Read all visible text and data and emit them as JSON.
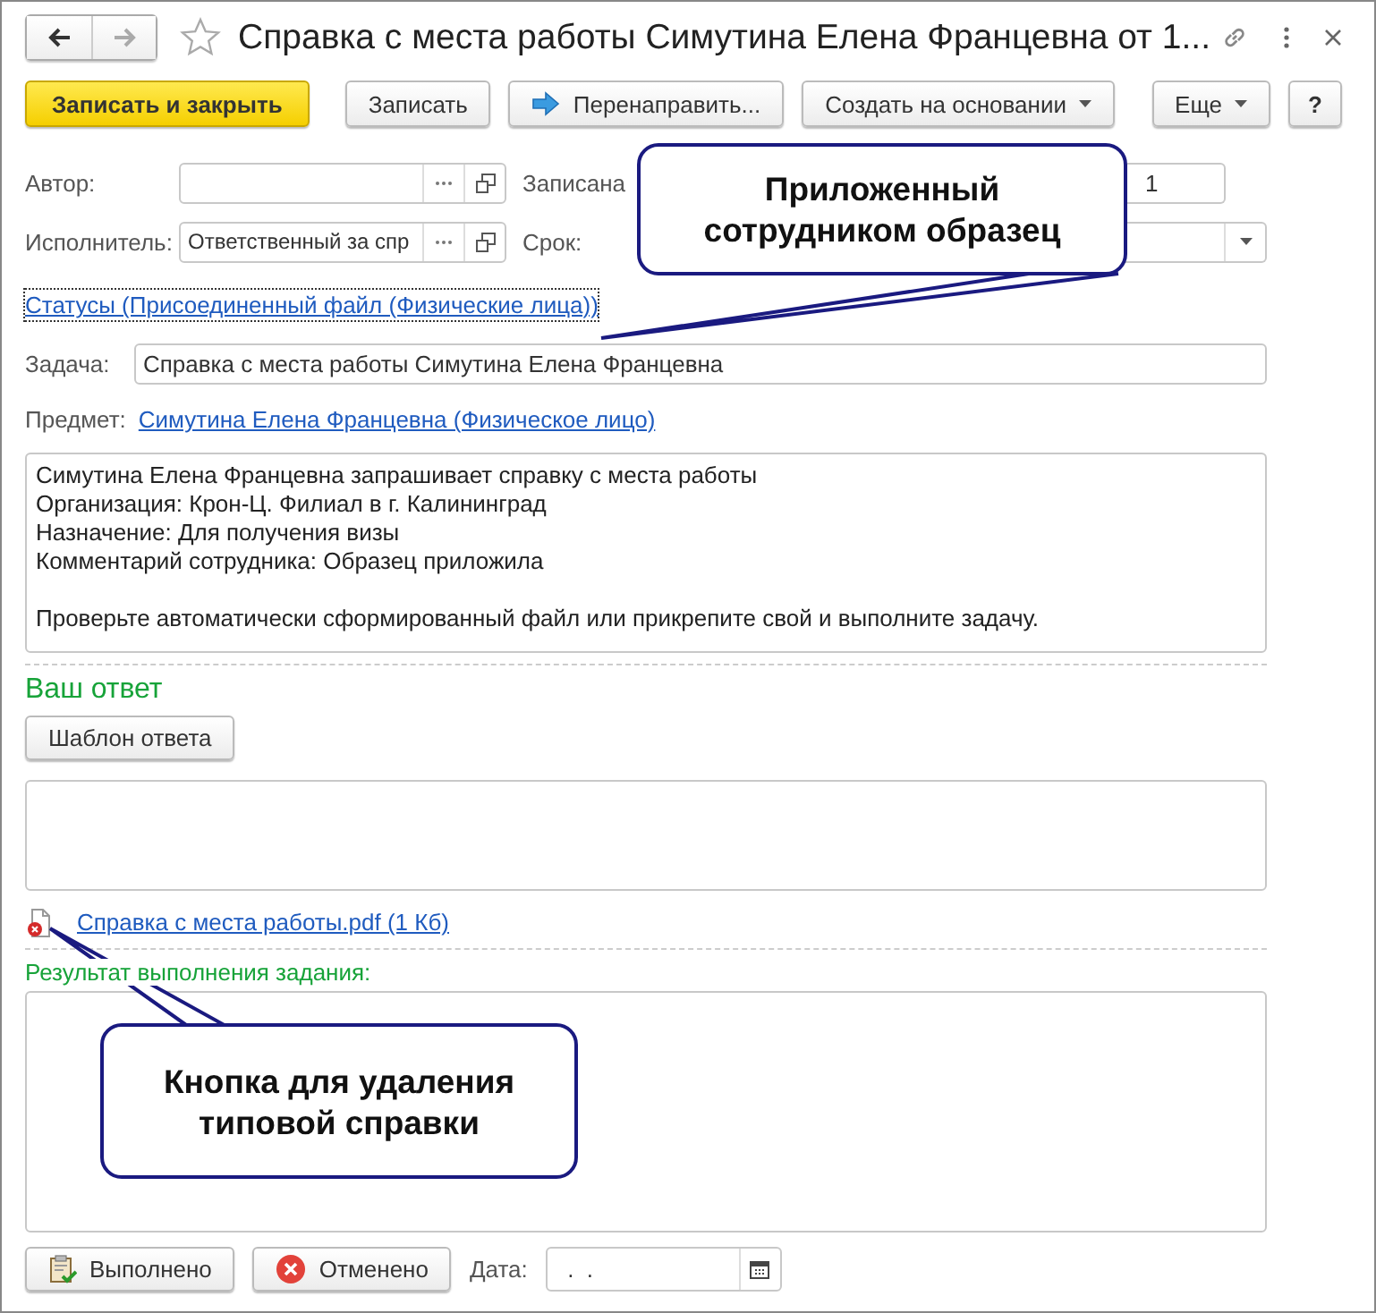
{
  "window": {
    "title": "Справка с места работы Симутина Елена Францевна от 1..."
  },
  "nav": [
    {
      "kind": "back",
      "disabled": false
    },
    {
      "kind": "forward",
      "disabled": true
    }
  ],
  "toolbar": [
    {
      "label": "Записать и закрыть",
      "kind": "default"
    },
    {
      "label": "Записать",
      "kind": "plain"
    },
    {
      "label": "Перенаправить...",
      "kind": "redirect"
    },
    {
      "label": "Создать на основании",
      "kind": "menu"
    }
  ],
  "toolbar_right": [
    {
      "label": "Еще",
      "kind": "menu"
    },
    {
      "label": "?",
      "kind": "plain"
    }
  ],
  "author": {
    "label": "Автор:"
  },
  "recorded": {
    "label": "Записана",
    "value": "1"
  },
  "executor": {
    "label": "Исполнитель:",
    "value": "Ответственный за спр"
  },
  "deadline": {
    "label": "Срок:"
  },
  "statuses_link": {
    "text": "Статусы (Присоединенный файл (Физические лица))",
    "focused": true
  },
  "task": {
    "label": "Задача:",
    "value": "Справка с места работы Симутина Елена Францевна"
  },
  "subject": {
    "label": "Предмет:",
    "link": "Симутина Елена Францевна (Физическое лицо)"
  },
  "description": {
    "lines": [
      "Симутина Елена Францевна запрашивает справку с места работы",
      "Организация: Крон-Ц. Филиал в г. Калининград",
      "Назначение: Для получения визы",
      "Комментарий сотрудника: Образец приложила"
    ],
    "note": "Проверьте автоматически сформированный файл или прикрепите свой и выполните задачу."
  },
  "answer": {
    "heading": "Ваш ответ",
    "template_button": "Шаблон ответа"
  },
  "attachment": {
    "name": "Справка с места работы.pdf (1 Кб)"
  },
  "result": {
    "label": "Результат выполнения задания:"
  },
  "footer": {
    "buttons": [
      {
        "label": "Выполнено",
        "kind": "done"
      },
      {
        "label": "Отменено",
        "kind": "cancel"
      }
    ],
    "date": {
      "label": "Дата:",
      "value": "  .  ."
    }
  },
  "callouts": [
    {
      "text": "Приложенный сотрудником образец",
      "kind": "top"
    },
    {
      "text": "Кнопка для удаления типовой справки",
      "kind": "bottom"
    }
  ]
}
